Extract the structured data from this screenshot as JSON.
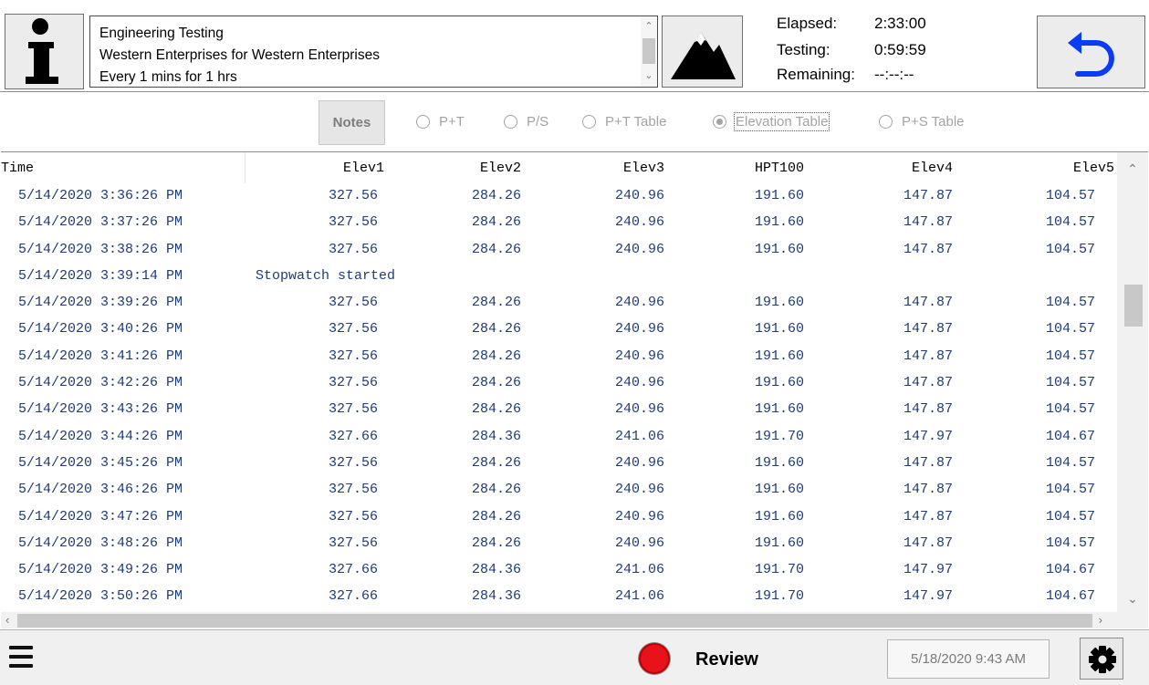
{
  "header": {
    "info_lines": [
      "Engineering Testing",
      "Western Enterprises for Western Enterprises",
      "Every 1 mins for 1 hrs"
    ],
    "elapsed_label": "Elapsed:",
    "elapsed_value": "2:33:00",
    "testing_label": "Testing:",
    "testing_value": "0:59:59",
    "remaining_label": "Remaining:",
    "remaining_value": "--:--:--",
    "icons": {
      "info": "info-icon",
      "mountain": "mountain-icon",
      "back": "undo-arrow-icon"
    },
    "back_icon_color": "#0a3cf5"
  },
  "tabs": {
    "notes_label": "Notes",
    "options": [
      {
        "label": "P+T",
        "selected": false
      },
      {
        "label": "P/S",
        "selected": false
      },
      {
        "label": "P+T Table",
        "selected": false
      },
      {
        "label": "Elevation Table",
        "selected": true
      },
      {
        "label": "P+S Table",
        "selected": false
      }
    ]
  },
  "table": {
    "columns": [
      "Time",
      "Elev1",
      "Elev2",
      "Elev3",
      "HPT100",
      "Elev4",
      "Elev5"
    ],
    "rows": [
      [
        "5/14/2020 3:36:26 PM",
        "327.56",
        "284.26",
        "240.96",
        "191.60",
        "147.87",
        "104.57"
      ],
      [
        "5/14/2020 3:37:26 PM",
        "327.56",
        "284.26",
        "240.96",
        "191.60",
        "147.87",
        "104.57"
      ],
      [
        "5/14/2020 3:38:26 PM",
        "327.56",
        "284.26",
        "240.96",
        "191.60",
        "147.87",
        "104.57"
      ],
      [
        "5/14/2020 3:39:14 PM",
        "Stopwatch started",
        "",
        "",
        "",
        "",
        ""
      ],
      [
        "5/14/2020 3:39:26 PM",
        "327.56",
        "284.26",
        "240.96",
        "191.60",
        "147.87",
        "104.57"
      ],
      [
        "5/14/2020 3:40:26 PM",
        "327.56",
        "284.26",
        "240.96",
        "191.60",
        "147.87",
        "104.57"
      ],
      [
        "5/14/2020 3:41:26 PM",
        "327.56",
        "284.26",
        "240.96",
        "191.60",
        "147.87",
        "104.57"
      ],
      [
        "5/14/2020 3:42:26 PM",
        "327.56",
        "284.26",
        "240.96",
        "191.60",
        "147.87",
        "104.57"
      ],
      [
        "5/14/2020 3:43:26 PM",
        "327.56",
        "284.26",
        "240.96",
        "191.60",
        "147.87",
        "104.57"
      ],
      [
        "5/14/2020 3:44:26 PM",
        "327.66",
        "284.36",
        "241.06",
        "191.70",
        "147.97",
        "104.67"
      ],
      [
        "5/14/2020 3:45:26 PM",
        "327.56",
        "284.26",
        "240.96",
        "191.60",
        "147.87",
        "104.57"
      ],
      [
        "5/14/2020 3:46:26 PM",
        "327.56",
        "284.26",
        "240.96",
        "191.60",
        "147.87",
        "104.57"
      ],
      [
        "5/14/2020 3:47:26 PM",
        "327.56",
        "284.26",
        "240.96",
        "191.60",
        "147.87",
        "104.57"
      ],
      [
        "5/14/2020 3:48:26 PM",
        "327.56",
        "284.26",
        "240.96",
        "191.60",
        "147.87",
        "104.57"
      ],
      [
        "5/14/2020 3:49:26 PM",
        "327.66",
        "284.36",
        "241.06",
        "191.70",
        "147.97",
        "104.67"
      ],
      [
        "5/14/2020 3:50:26 PM",
        "327.66",
        "284.36",
        "241.06",
        "191.70",
        "147.97",
        "104.67"
      ]
    ],
    "text_color": "#1e3c74"
  },
  "footer": {
    "review_label": "Review",
    "date_value": "5/18/2020 9:43 AM",
    "record_color": "#e8121a",
    "icons": {
      "menu": "hamburger-menu-icon",
      "record": "record-icon",
      "settings": "gear-icon"
    }
  }
}
